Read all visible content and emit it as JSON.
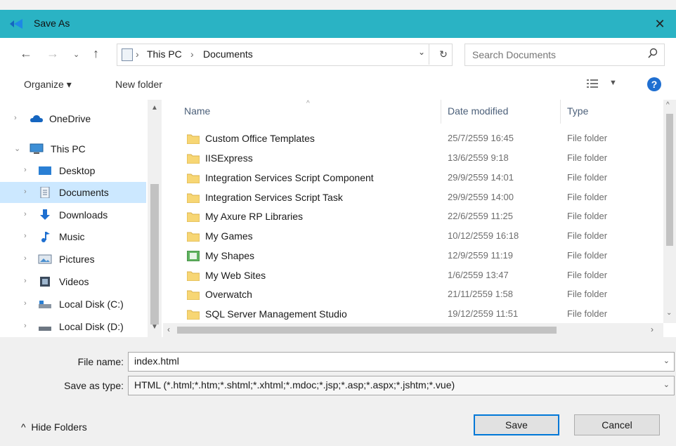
{
  "window": {
    "title": "Save As",
    "close_glyph": "✕"
  },
  "address": {
    "crumbs": [
      "This PC",
      "Documents"
    ],
    "separator": "›",
    "search_placeholder": "Search Documents"
  },
  "toolbar": {
    "organize": "Organize ▾",
    "new_folder": "New folder",
    "help": "?"
  },
  "sidebar": {
    "items": [
      {
        "label": "OneDrive",
        "icon": "cloud-icon"
      },
      {
        "label": "This PC",
        "icon": "computer-icon"
      },
      {
        "label": "Desktop",
        "icon": "desktop-icon"
      },
      {
        "label": "Documents",
        "icon": "documents-icon"
      },
      {
        "label": "Downloads",
        "icon": "download-icon"
      },
      {
        "label": "Music",
        "icon": "music-icon"
      },
      {
        "label": "Pictures",
        "icon": "pictures-icon"
      },
      {
        "label": "Videos",
        "icon": "videos-icon"
      },
      {
        "label": "Local Disk (C:)",
        "icon": "drive-icon"
      },
      {
        "label": "Local Disk (D:)",
        "icon": "drive-icon"
      }
    ]
  },
  "filelist": {
    "columns": {
      "name": "Name",
      "date": "Date modified",
      "type": "Type"
    },
    "rows": [
      {
        "name": "Custom Office Templates",
        "date": "25/7/2559 16:45",
        "type": "File folder"
      },
      {
        "name": "IISExpress",
        "date": "13/6/2559 9:18",
        "type": "File folder"
      },
      {
        "name": "Integration Services Script Component",
        "date": "29/9/2559 14:01",
        "type": "File folder"
      },
      {
        "name": "Integration Services Script Task",
        "date": "29/9/2559 14:00",
        "type": "File folder"
      },
      {
        "name": "My Axure RP Libraries",
        "date": "22/6/2559 11:25",
        "type": "File folder"
      },
      {
        "name": "My Games",
        "date": "10/12/2559 16:18",
        "type": "File folder"
      },
      {
        "name": "My Shapes",
        "date": "12/9/2559 11:19",
        "type": "File folder"
      },
      {
        "name": "My Web Sites",
        "date": "1/6/2559 13:47",
        "type": "File folder"
      },
      {
        "name": "Overwatch",
        "date": "21/11/2559 1:58",
        "type": "File folder"
      },
      {
        "name": "SQL Server Management Studio",
        "date": "19/12/2559 11:51",
        "type": "File folder"
      }
    ]
  },
  "bottom": {
    "file_name_label": "File name:",
    "file_name_value": "index.html",
    "save_type_label": "Save as type:",
    "save_type_value": "HTML (*.html;*.htm;*.shtml;*.xhtml;*.mdoc;*.jsp;*.asp;*.aspx;*.jshtm;*.vue)",
    "hide_folders": "Hide Folders",
    "save": "Save",
    "cancel": "Cancel"
  },
  "colors": {
    "titlebar": "#2ab3c4",
    "selected": "#cce8ff",
    "accent": "#0078d7"
  }
}
